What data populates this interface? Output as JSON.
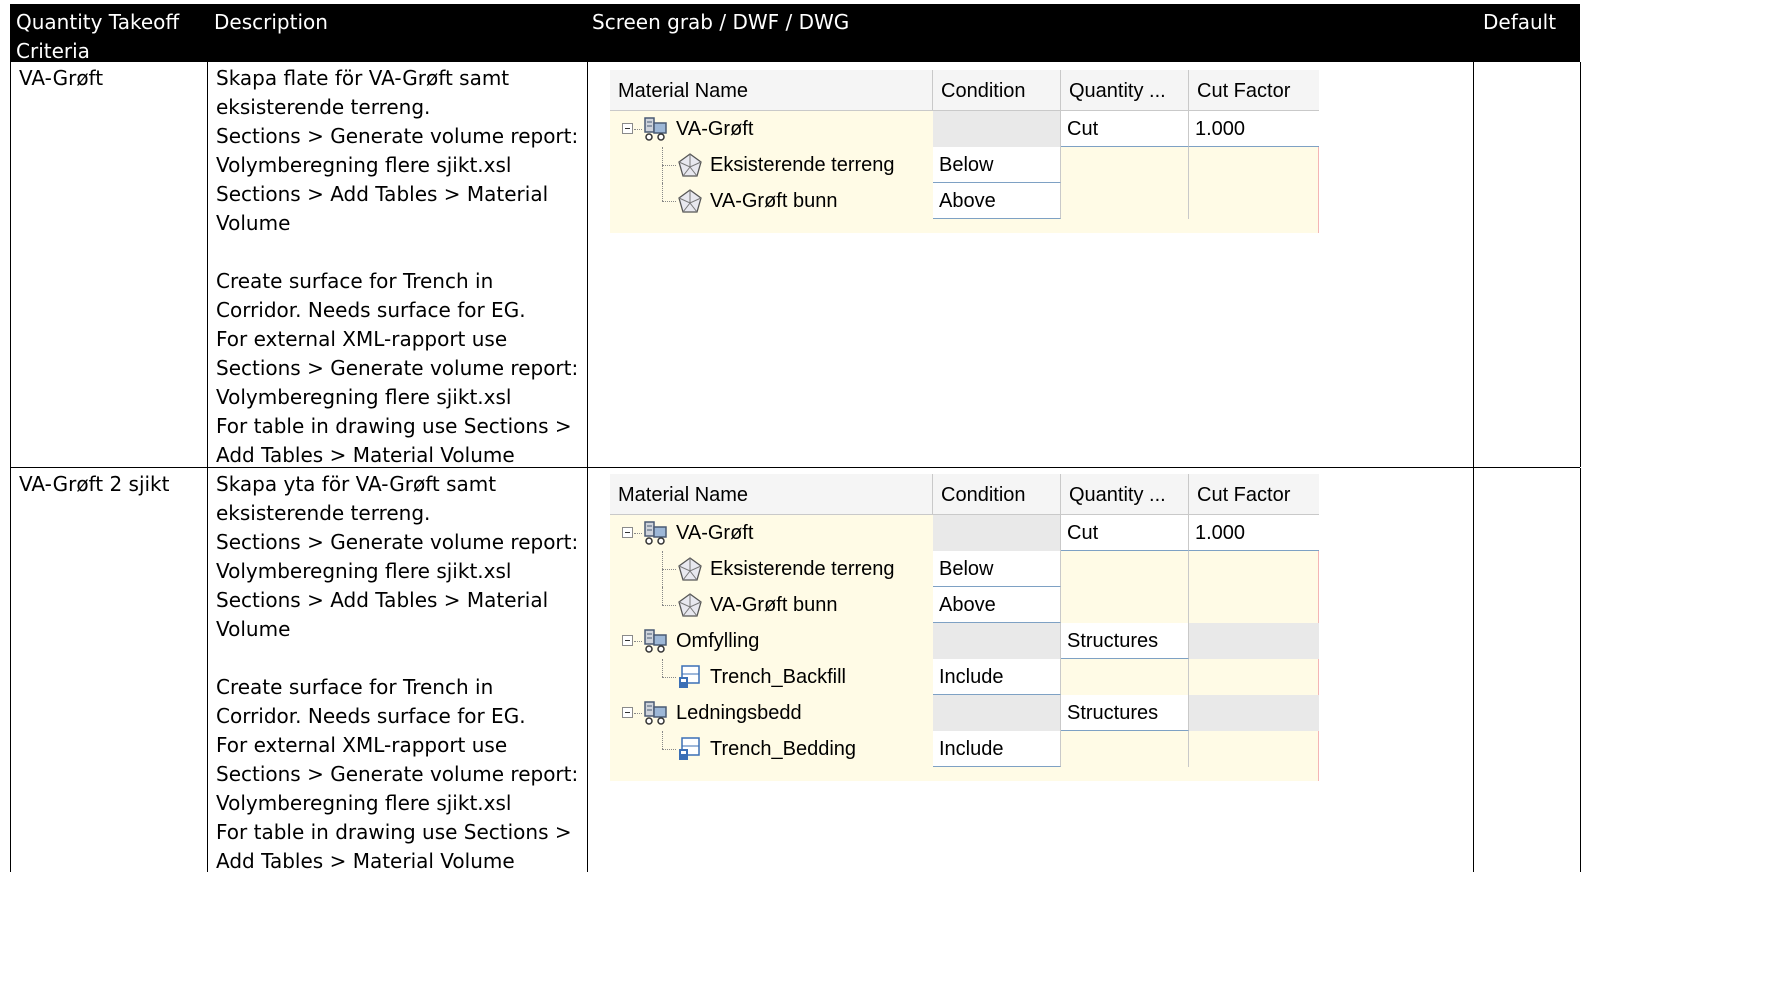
{
  "header": {
    "col1": "Quantity Takeoff\nCriteria",
    "col2": "Description",
    "col3": "Screen grab / DWF / DWG",
    "col4": "Default"
  },
  "rows": [
    {
      "criteria": "VA-Grøft",
      "description": "Skapa flate för VA-Grøft samt\neksisterende terreng.\nSections > Generate volume report:\nVolymberegning flere sjikt.xsl\nSections > Add Tables > Material\nVolume\n\nCreate surface for Trench in\nCorridor. Needs surface for EG.\nFor external XML-rapport use\nSections > Generate volume report:\nVolymberegning flere sjikt.xsl\nFor table in drawing use Sections >\nAdd Tables > Material Volume",
      "grid": {
        "columns": [
          "Material Name",
          "Condition",
          "Quantity ...",
          "Cut Factor"
        ],
        "items": [
          {
            "level": 0,
            "icon": "truck-icon",
            "name": "VA-Grøft",
            "condition": "",
            "quantity": "Cut",
            "cut_factor": "1.000"
          },
          {
            "level": 1,
            "icon": "surface-icon",
            "name": "Eksisterende terreng",
            "condition": "Below",
            "quantity": "",
            "cut_factor": ""
          },
          {
            "level": 1,
            "icon": "surface-icon",
            "name": "VA-Grøft bunn",
            "condition": "Above",
            "quantity": "",
            "cut_factor": ""
          }
        ]
      }
    },
    {
      "criteria": "VA-Grøft 2 sjikt",
      "description": "Skapa yta för VA-Grøft samt\neksisterende terreng.\nSections > Generate volume report:\nVolymberegning flere sjikt.xsl\nSections > Add Tables > Material\nVolume\n\nCreate surface for Trench in\nCorridor. Needs surface for EG.\nFor external XML-rapport use\nSections > Generate volume report:\nVolymberegning flere sjikt.xsl\nFor table in drawing use Sections >\nAdd Tables > Material Volume",
      "grid": {
        "columns": [
          "Material Name",
          "Condition",
          "Quantity ...",
          "Cut Factor"
        ],
        "items": [
          {
            "level": 0,
            "icon": "truck-icon",
            "name": "VA-Grøft",
            "condition": "",
            "quantity": "Cut",
            "cut_factor": "1.000"
          },
          {
            "level": 1,
            "icon": "surface-icon",
            "name": "Eksisterende terreng",
            "condition": "Below",
            "quantity": "",
            "cut_factor": ""
          },
          {
            "level": 1,
            "icon": "surface-icon",
            "name": "VA-Grøft bunn",
            "condition": "Above",
            "quantity": "",
            "cut_factor": ""
          },
          {
            "level": 0,
            "icon": "truck-icon",
            "name": "Omfylling",
            "condition": "",
            "quantity": "Structures",
            "cut_factor": ""
          },
          {
            "level": 1,
            "icon": "structure-icon",
            "name": "Trench_Backfill",
            "condition": "Include",
            "quantity": "",
            "cut_factor": ""
          },
          {
            "level": 0,
            "icon": "truck-icon",
            "name": "Ledningsbedd",
            "condition": "",
            "quantity": "Structures",
            "cut_factor": ""
          },
          {
            "level": 1,
            "icon": "structure-icon",
            "name": "Trench_Bedding",
            "condition": "Include",
            "quantity": "",
            "cut_factor": ""
          }
        ]
      }
    }
  ]
}
